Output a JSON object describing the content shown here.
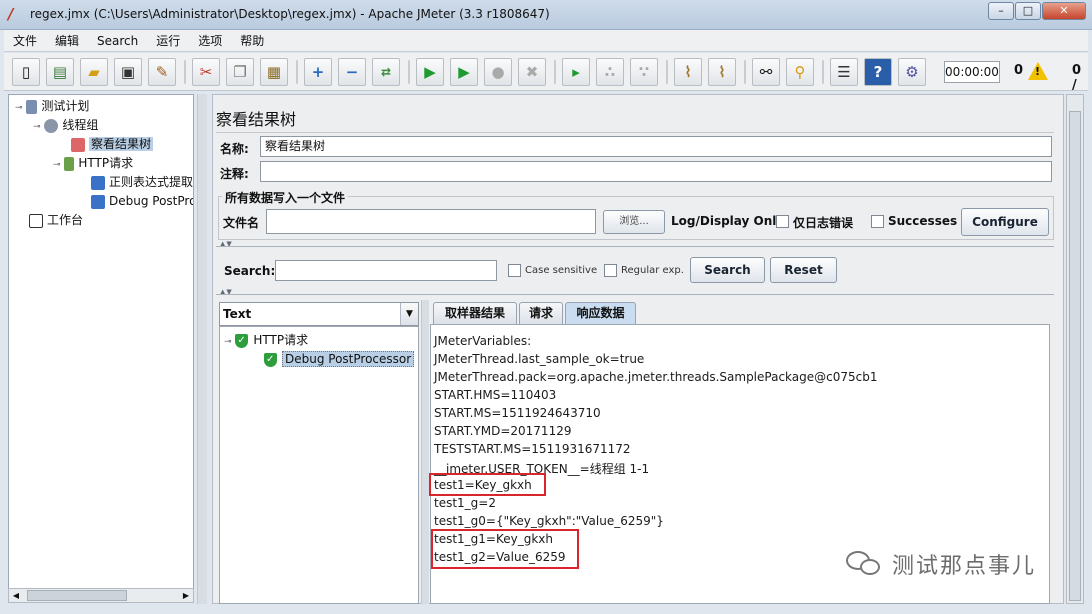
{
  "window": {
    "title": "regex.jmx (C:\\Users\\Administrator\\Desktop\\regex.jmx) - Apache JMeter (3.3 r1808647)",
    "app_icon": "/"
  },
  "menu": [
    "文件",
    "编辑",
    "Search",
    "运行",
    "选项",
    "帮助"
  ],
  "toolbar": {
    "timer": "00:00:00",
    "error_count": "0",
    "warn_symbol": "!",
    "thread_count": "0 /"
  },
  "tree": {
    "items": [
      {
        "label": "测试计划",
        "icon": "flask-icon"
      },
      {
        "label": "线程组",
        "icon": "gear-icon"
      },
      {
        "label": "察看结果树",
        "icon": "chart-icon"
      },
      {
        "label": "HTTP请求",
        "icon": "pen-icon"
      },
      {
        "label": "正则表达式提取",
        "icon": "arrow-icon"
      },
      {
        "label": "Debug PostPro",
        "icon": "arrow-icon"
      },
      {
        "label": "工作台",
        "icon": "workbench-icon"
      }
    ]
  },
  "panel": {
    "title": "察看结果树",
    "name_label": "名称:",
    "name_value": "察看结果树",
    "comment_label": "注释:",
    "comment_value": "",
    "group_title": "所有数据写入一个文件",
    "filename_label": "文件名",
    "filename_value": "",
    "browse_label": "浏览...",
    "log_display_label": "Log/Display Only:",
    "errors_only_label": "仅日志错误",
    "successes_label": "Successes",
    "configure_label": "Configure"
  },
  "search": {
    "label": "Search:",
    "value": "",
    "case_sensitive_label": "Case sensitive",
    "regular_exp_label": "Regular exp.",
    "search_button": "Search",
    "reset_button": "Reset"
  },
  "results": {
    "renderer": "Text",
    "items": [
      {
        "label": "HTTP请求",
        "status": "success"
      },
      {
        "label": "Debug PostProcessor",
        "status": "success"
      }
    ]
  },
  "tabs": [
    "取样器结果",
    "请求",
    "响应数据"
  ],
  "active_tab": "响应数据",
  "response_lines": [
    "JMeterVariables:",
    "JMeterThread.last_sample_ok=true",
    "JMeterThread.pack=org.apache.jmeter.threads.SamplePackage@c075cb1",
    "START.HMS=110403",
    "START.MS=1511924643710",
    "START.YMD=20171129",
    "TESTSTART.MS=1511931671172",
    "__jmeter.USER_TOKEN__=线程组 1-1",
    "test1=Key_gkxh",
    "test1_g=2",
    "test1_g0={\"Key_gkxh\":\"Value_6259\"}",
    "test1_g1=Key_gkxh",
    "test1_g2=Value_6259"
  ],
  "watermark": "测试那点事儿",
  "colors": {
    "highlight_box": "#d9262c",
    "selection": "#b8cfe5",
    "success": "#2e9e3c"
  }
}
